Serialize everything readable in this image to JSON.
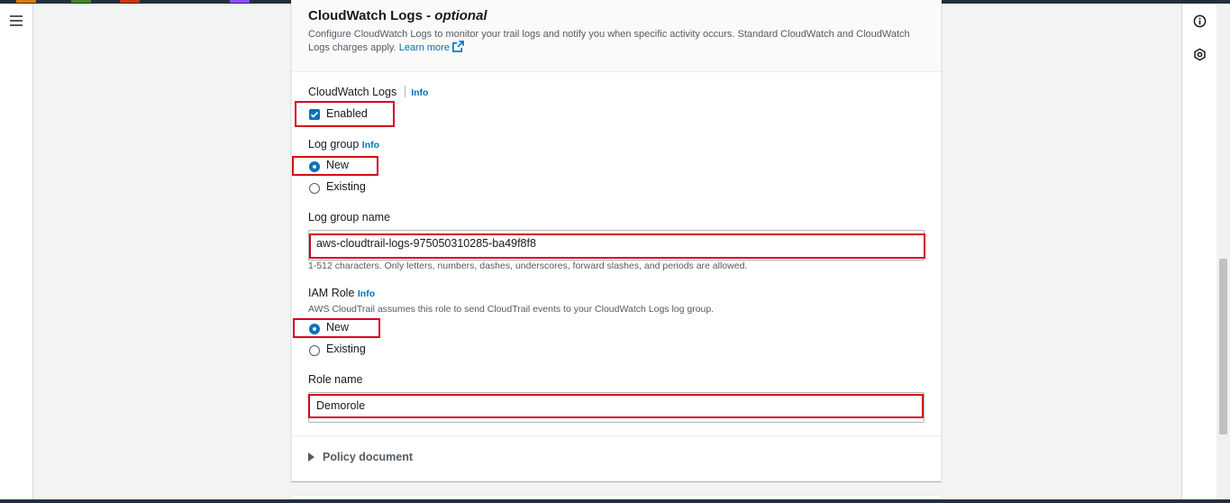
{
  "section": {
    "title": "CloudWatch Logs",
    "title_suffix": "optional",
    "description": "Configure CloudWatch Logs to monitor your trail logs and notify you when specific activity occurs. Standard CloudWatch and CloudWatch Logs charges apply.",
    "learn_more": "Learn more"
  },
  "cloudwatch_logs": {
    "label": "CloudWatch Logs",
    "info": "Info",
    "checkbox_label": "Enabled",
    "checked": true
  },
  "log_group": {
    "label": "Log group",
    "info": "Info",
    "options": [
      "New",
      "Existing"
    ],
    "selected": "New"
  },
  "log_group_name": {
    "label": "Log group name",
    "value": "aws-cloudtrail-logs-975050310285-ba49f8f8",
    "constraint": "1-512 characters. Only letters, numbers, dashes, underscores, forward slashes, and periods are allowed."
  },
  "iam_role": {
    "label": "IAM Role",
    "info": "Info",
    "description": "AWS CloudTrail assumes this role to send CloudTrail events to your CloudWatch Logs log group.",
    "options": [
      "New",
      "Existing"
    ],
    "selected": "New"
  },
  "role_name": {
    "label": "Role name",
    "value": "Demorole"
  },
  "policy_document": {
    "label": "Policy document"
  },
  "icons": {
    "nav": "hamburger-menu-icon",
    "rail_top": "info-circle-icon",
    "rail_second": "hexagon-settings-icon",
    "external": "external-link-icon",
    "expand": "caret-right-icon"
  },
  "colors": {
    "accent": "#0073bb",
    "highlight": "#d6001c",
    "topbar": "#232f3e",
    "background": "#f2f3f3"
  }
}
